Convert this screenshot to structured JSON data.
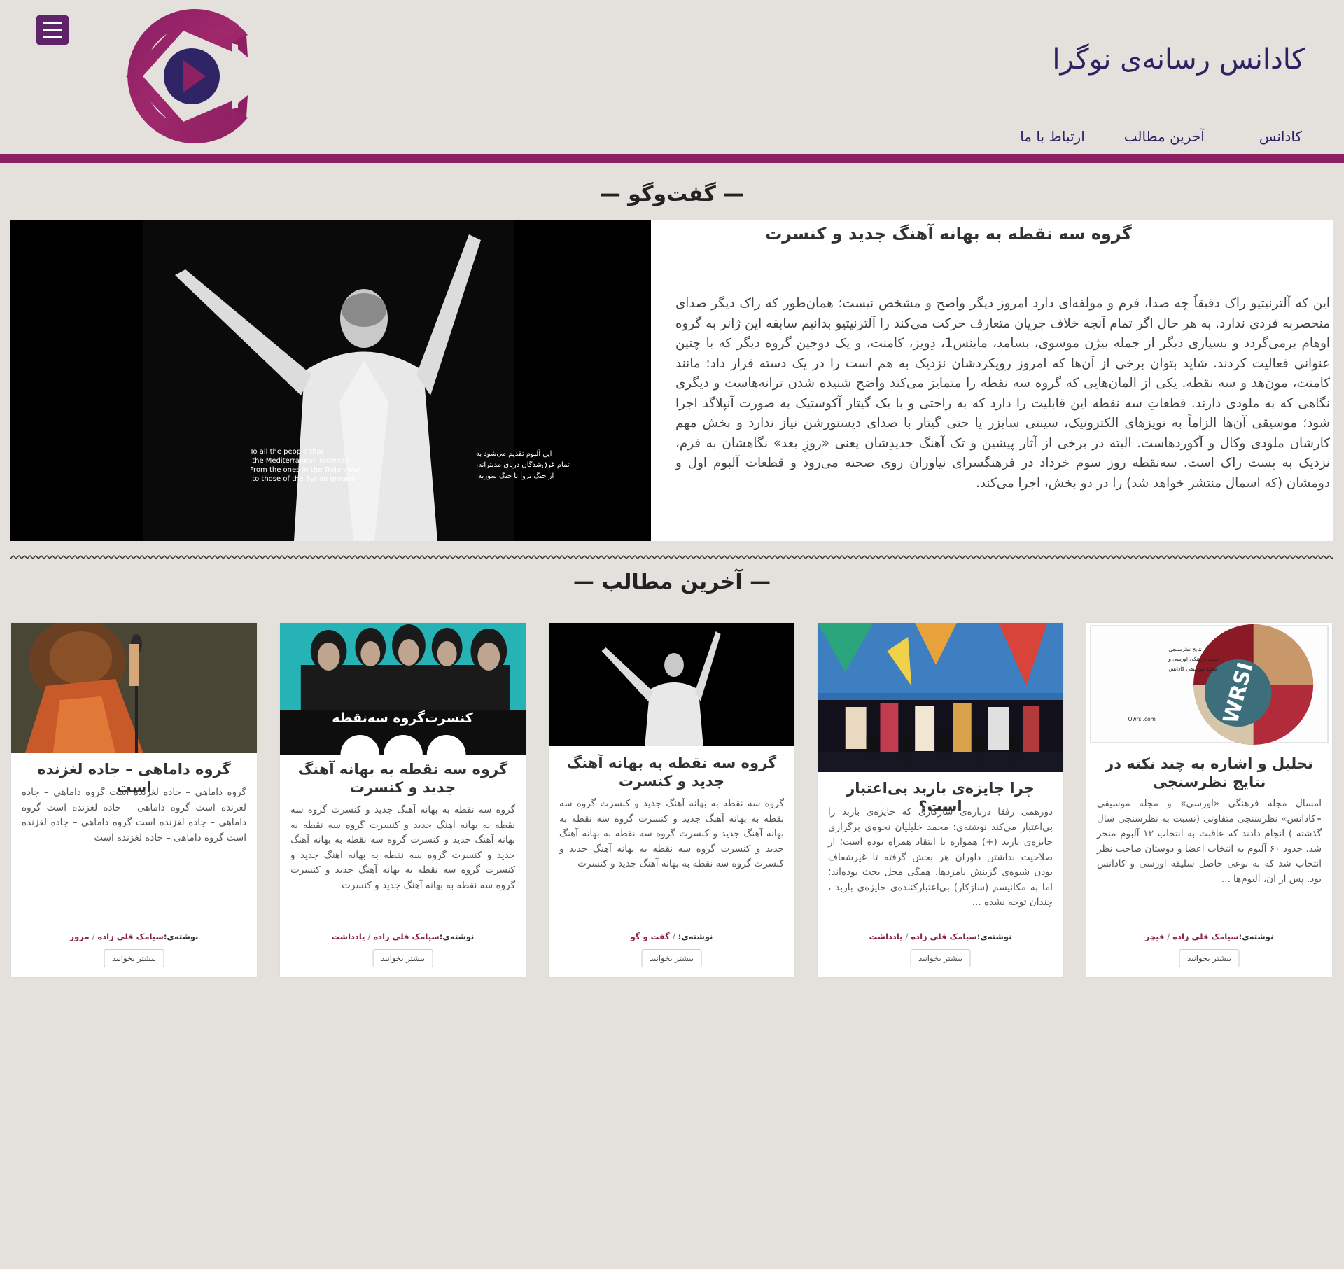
{
  "header": {
    "site_title": "کادانس رسانه‌ی نوگرا",
    "nav": [
      {
        "label": "کادانس"
      },
      {
        "label": "آخرین مطالب"
      },
      {
        "label": "ارتباط با ما"
      }
    ],
    "brand_color": "#8d1f62",
    "menu_button_color": "#5e2369"
  },
  "interview_section": {
    "heading": "— گفت‌وگو —",
    "featured": {
      "title": "گروه سه نقطه به بهانه آهنگ جدید و کنسرت",
      "image_caption_en": [
        "To all the people that",
        "the Mediterranean drowned.",
        "From the ones in the Trojan war",
        "to those of the Syrian ground."
      ],
      "image_caption_fa": [
        "این آلبوم تقدیم می‌شود به",
        "تمام غرق‌شدگان دریای مدیترانه،",
        "از جنگ تروا تا جنگ سوریه."
      ],
      "body": "این که آلترنیتیو راک دقیقاً چه صدا، فرم و مولفه‌ای دارد امروز دیگر واضح و مشخص نیست؛ همان‌طور که راک دیگر صدای منحصربه فردی ندارد. به هر حال اگر تمام آنچه خلاف جریان متعارف حرکت می‌کند را آلترنیتیو بدانیم سابقه این ژانر به گروه اوهام برمی‌گردد و بسیاری دیگر از جمله بیژن موسوی، بسامد، ماینس1، دِویز، کامنت، و یک دوجین گروه دیگر که با چنین عنوانی فعالیت کردند. شاید بتوان برخی از آن‌ها که امروز رویکردشان نزدیک به هم است را در یک دسته قرار داد: مانند کامنت، مون‌هد و سه نقطه. یکی از المان‌هایی که گروه سه نقطه را متمایز می‌کند واضح شنیده شدن ترانه‌هاست و دیگری نگاهی که به ملودی دارند. قطعاتِ سه نقطه این قابلیت را دارد که به راحتی و با یک گیتار آکوستیک به صورت آنپلاگد اجرا شود؛ موسیقی آن‌ها الزاماً به نویزهای الکترونیک، سینتی سایزر یا حتی گیتار با صدای دیستورشن نیاز ندارد و بخش مهم کارشان ملودی وکال و آکوردهاست. البته در برخی از آثار پیشین و تک آهنگ جدیدِشان یعنی «روزِ بعد» نگاهشان به فرم، نزدیک به پست راک است. سه‌نقطه روز سوم خرداد در فرهنگسرای نیاوران روی صحنه می‌رود و قطعات آلبوم اول و دومشان (که اسمال منتشر خواهد شد) را در دو بخش، اجرا می‌کند."
    }
  },
  "latest_section": {
    "heading": "— آخرین مطالب —",
    "author_label": "نوشته‌ی:",
    "read_more_label": "بیشتر بخوانید",
    "cards": [
      {
        "title": "تحلیل و اشاره به چند نکته در نتایج نظرسنجی",
        "excerpt": "امسال مجله فرهنگی «اورسی» و مجله موسیقی «کادانس» نظرسنجی متفاوتی (نسبت به نظرسنجی سال گذشته ) انجام دادند که عاقبت به انتخاب ۱۳ آلبوم منجر شد. حدود ۶۰ آلبوم به انتخاب اعضا و دوستان صاحب نظر انتخاب شد که به نوعی حاصل سلیقه اورسی و کادانس بود. پس از آن، آلبوم‌ها ...",
        "author": "سیامک قلی زاده",
        "category": "فیچر",
        "image_text": [
          "نتایج نظرسنجی",
          "مجله فرهنگی اورسی و",
          "مجله موسیقی کادانس",
          "Owrsi.com"
        ],
        "image_logo": "WRSI"
      },
      {
        "title": "چرا جایزه‌ی باربد بی‌اعتبار است؟",
        "excerpt": "دورهمی رفقا درباره‌ی سازکاری که جایزه‌ی باربد را بی‌اعتبار می‌کند نوشته‌ی: محمد خلیلیان نحوه‌ی برگزاری جایزه‌ی باربد (+) همواره با انتقاد همراه بوده است؛ از صلاحیت نداشتن داوران هر بخش گرفته تا غیرشفاف بودن شیوه‌ی گزینش نامزدها، همگی محل بحث بوده‌اند؛ اما به مکانیسم (سازکار) بی‌اعتبارکننده‌ی جایزه‌ی باربد ، چندان توجه نشده ...",
        "author": "سیامک قلی زاده",
        "category": "یادداشت"
      },
      {
        "title": "گروه سه نقطه به بهانه آهنگ جدید و کنسرت",
        "excerpt": "گروه سه نقطه به بهانه آهنگ جدید و کنسرت گروه سه نقطه به بهانه آهنگ جدید و کنسرت گروه سه نقطه به بهانه آهنگ جدید و کنسرت گروه سه نقطه به بهانه آهنگ جدید و کنسرت گروه سه نقطه به بهانه آهنگ جدید و کنسرت گروه سه نقطه به بهانه آهنگ جدید و کنسرت",
        "author": "",
        "category": "گفت و گو"
      },
      {
        "title": "گروه سه نقطه به بهانه آهنگ جدید و کنسرت",
        "excerpt": "گروه سه نقطه به بهانه آهنگ جدید و کنسرت گروه سه نقطه به بهانه آهنگ جدید و کنسرت گروه سه نقطه به بهانه آهنگ جدید و کنسرت گروه سه نقطه به بهانه آهنگ جدید و کنسرت گروه سه نقطه به بهانه آهنگ جدید و کنسرت گروه سه نقطه به بهانه آهنگ جدید و کنسرت گروه سه نقطه به بهانه آهنگ جدید و کنسرت",
        "author": "سیامک قلی زاده",
        "category": "یادداشت",
        "image_text": [
          "کنسرت‌گروه سه‌نقطه"
        ]
      },
      {
        "title": "گروه داماهی – جاده لغزنده است",
        "excerpt": "گروه داماهی – جاده لغزنده است گروه داماهی – جاده لغزنده است گروه داماهی – جاده لغزنده است گروه داماهی – جاده لغزنده است گروه داماهی – جاده لغزنده است گروه داماهی – جاده لغزنده است",
        "author": "سیامک قلی زاده",
        "category": "مرور"
      }
    ]
  }
}
